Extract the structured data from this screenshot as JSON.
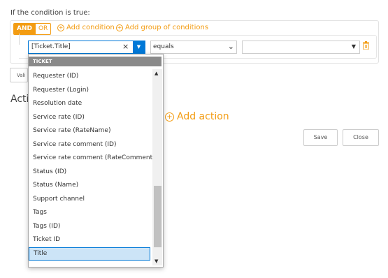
{
  "condition_label": "If the condition is true:",
  "logic": {
    "and": "AND",
    "or": "OR"
  },
  "add_condition": "Add condition",
  "add_group": "Add group of conditions",
  "field_select": {
    "value": "[Ticket.Title]",
    "clear": "×"
  },
  "operator_select": {
    "value": "equals"
  },
  "value_select": {
    "value": ""
  },
  "validate_button": "Vali",
  "actions_label": "Actio",
  "add_action": "Add action",
  "save": "Save",
  "close": "Close",
  "dropdown": {
    "header": "TICKET",
    "items": [
      "Requester (ID)",
      "Requester (Login)",
      "Resolution date",
      "Service rate (ID)",
      "Service rate (RateName)",
      "Service rate comment (ID)",
      "Service rate comment (RateComment)",
      "Status (ID)",
      "Status (Name)",
      "Support channel",
      "Tags",
      "Tags (ID)",
      "Ticket ID",
      "Title"
    ],
    "selected": "Title",
    "scroll_position": 0.6
  },
  "colors": {
    "accent": "#f39c12",
    "primary": "#0078d7"
  }
}
